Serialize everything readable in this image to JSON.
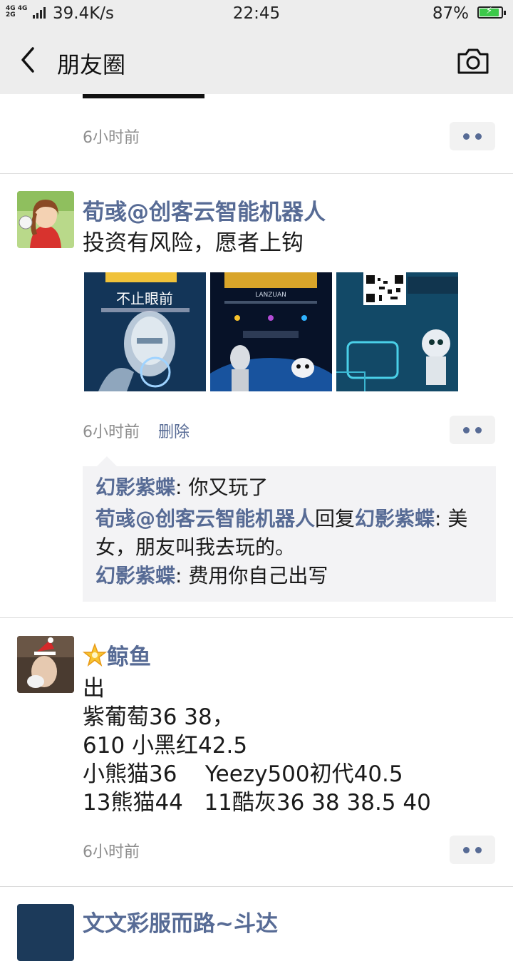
{
  "status_bar": {
    "network_top": "4G 4G",
    "network_bottom": "2G",
    "speed": "39.4K/s",
    "time": "22:45",
    "battery": "87%"
  },
  "nav": {
    "back_icon": "back-arrow-icon",
    "title": "朋友圈",
    "camera_icon": "camera-icon"
  },
  "posts": [
    {
      "time": "6小时前"
    },
    {
      "author": "荀彧@创客云智能机器人",
      "text": "投资有风险，愿者上钩",
      "photos": [
        "robot-poster-1",
        "robot-poster-2",
        "robot-poster-3"
      ],
      "photo_captions": [
        "不止眼前",
        "LANZUAN"
      ],
      "time": "6小时前",
      "delete_label": "删除",
      "comments": [
        {
          "name": "幻影紫蝶",
          "sep": ": ",
          "text": "你又玩了"
        },
        {
          "name": "荀彧@创客云智能机器人",
          "reply_word": "回复",
          "reply_to": "幻影紫蝶",
          "sep": ": ",
          "text": "美女，朋友叫我去玩的。"
        },
        {
          "name": "幻影紫蝶",
          "sep": ": ",
          "text": "费用你自己出写"
        }
      ]
    },
    {
      "author_icon": "star-icon",
      "author": "鲸鱼",
      "lines": [
        "出",
        "紫葡萄36  38，",
        "610  小黑红42.5",
        "小熊猫36    Yeezy500初代40.5",
        "13熊猫44   11酷灰36 38 38.5 40"
      ],
      "time": "6小时前"
    },
    {
      "author": "文文彩服而路~斗达"
    }
  ],
  "colors": {
    "link": "#576b95",
    "nav_bg": "#ededed",
    "battery": "#3cc94a"
  }
}
